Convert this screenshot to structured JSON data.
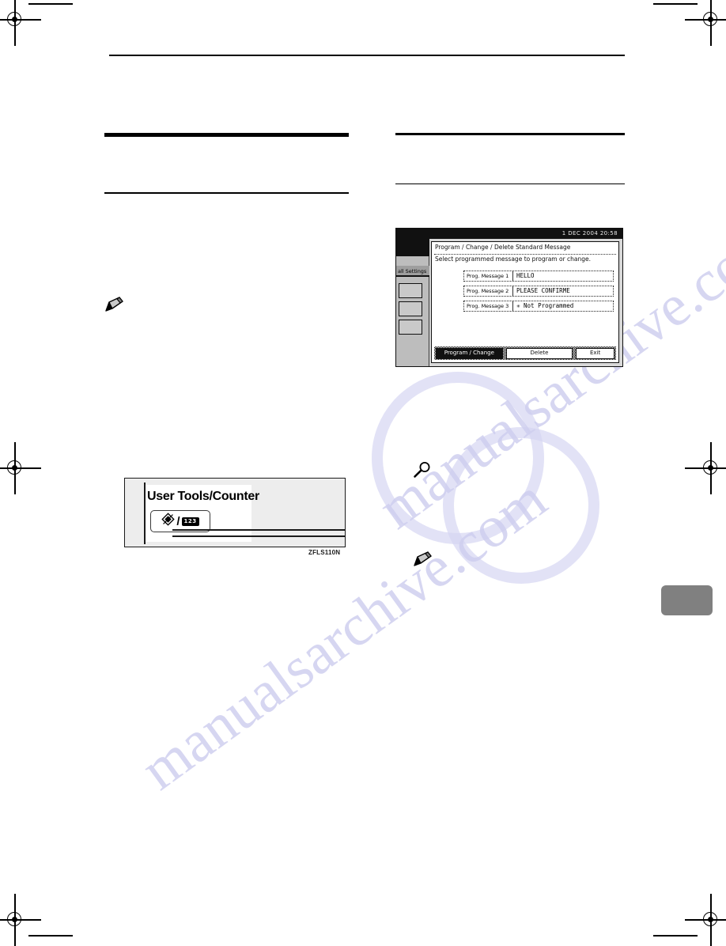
{
  "page": {
    "watermark": "manualsarchive.com",
    "watermark_fragment_1": "manualsarchive.com",
    "watermark_fragment_2": "manualsarchive.com"
  },
  "figure_lcd": {
    "statusbar": "1 DEC  2004 20:58",
    "title": "Program / Change / Delete Standard Message",
    "subtitle": "Select programmed message to program or change.",
    "sidebar_tab": "all Settings",
    "messages": [
      {
        "label": "Prog. Message 1",
        "value": "HELLO"
      },
      {
        "label": "Prog. Message 2",
        "value": "PLEASE CONFIRME"
      },
      {
        "label": "Prog. Message 3",
        "value": "✳ Not Programmed"
      }
    ],
    "buttons": {
      "program_change": "Program / Change",
      "delete": "Delete",
      "exit": "Exit"
    }
  },
  "figure_panel": {
    "title": "User Tools/Counter",
    "key_slash": "/",
    "key_counter": "123",
    "caption": "ZFLS110N"
  },
  "icons": {
    "note_pencil": "pencil-note-icon",
    "reference_magnifier": "magnifier-reference-icon"
  }
}
